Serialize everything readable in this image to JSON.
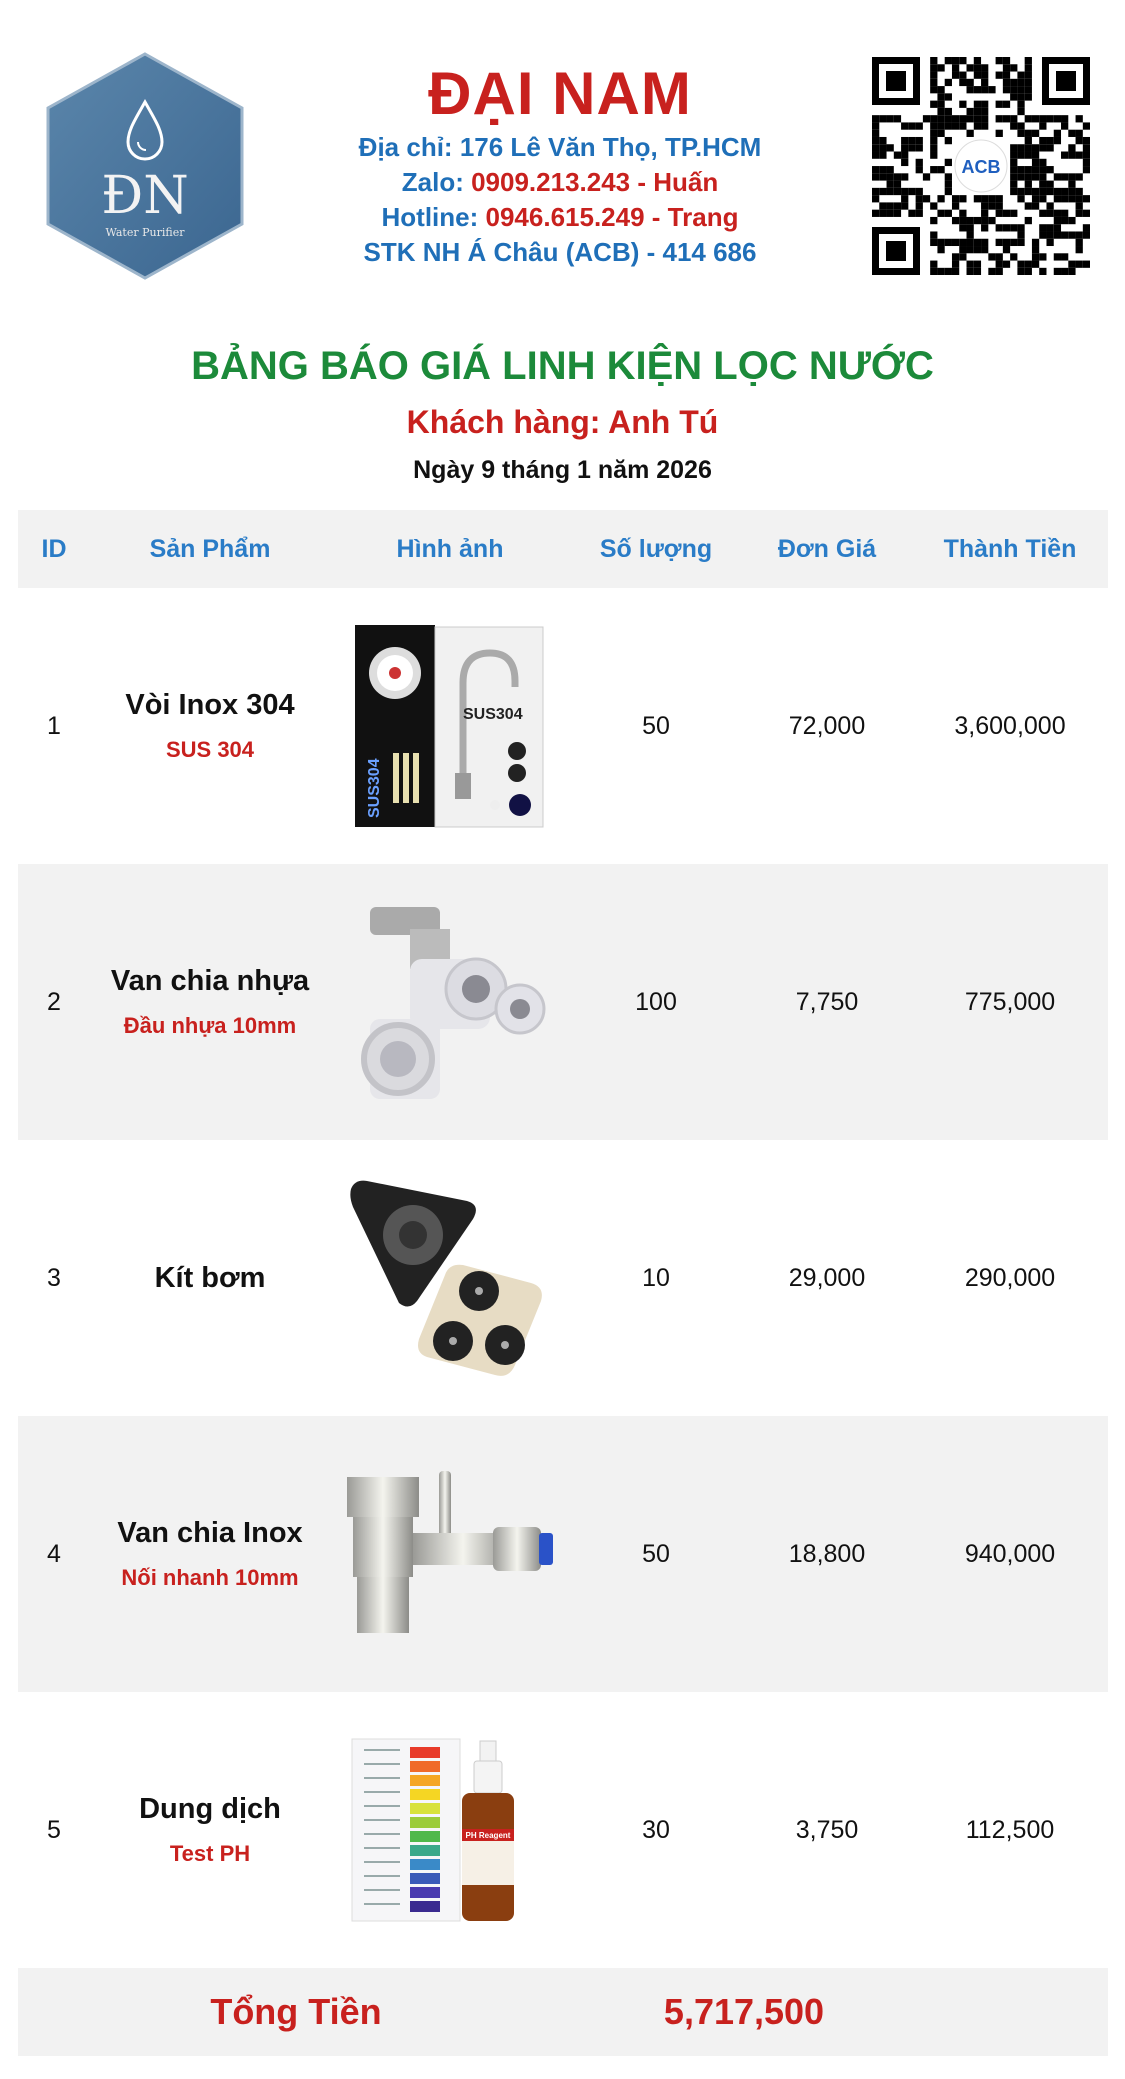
{
  "company": {
    "name": "ĐẠI NAM",
    "address_label": "Địa chỉ:",
    "address": "176 Lê Văn Thọ, TP.HCM",
    "zalo_label": "Zalo:",
    "zalo": "0909.213.243 - Huấn",
    "hotline_label": "Hotline:",
    "hotline": "0946.615.249 - Trang",
    "bank": "STK NH Á Châu (ACB) - 414 686",
    "logo_text": "ĐN",
    "logo_tagline": "Water Purifier",
    "qr_bank": "ACB"
  },
  "doc": {
    "title": "BẢNG BÁO GIÁ LINH KIỆN LỌC NƯỚC",
    "customer": "Khách hàng: Anh Tú",
    "date": "Ngày 9 tháng 1 năm 2026"
  },
  "table": {
    "headers": [
      "ID",
      "Sản Phẩm",
      "Hình ảnh",
      "Số lượng",
      "Đơn Giá",
      "Thành Tiền"
    ],
    "rows": [
      {
        "id": "1",
        "name": "Vòi Inox 304",
        "sub": "SUS 304",
        "image": "stainless-faucet",
        "img_text": "SUS304",
        "qty": "50",
        "unit": "72,000",
        "total": "3,600,000"
      },
      {
        "id": "2",
        "name": "Van chia nhựa",
        "sub": "Đầu nhựa 10mm",
        "image": "plastic-valve",
        "qty": "100",
        "unit": "7,750",
        "total": "775,000"
      },
      {
        "id": "3",
        "name": "Kít bơm",
        "sub": "",
        "image": "pump-kit",
        "qty": "10",
        "unit": "29,000",
        "total": "290,000"
      },
      {
        "id": "4",
        "name": "Van chia Inox",
        "sub": "Nối nhanh 10mm",
        "image": "stainless-valve",
        "qty": "50",
        "unit": "18,800",
        "total": "940,000"
      },
      {
        "id": "5",
        "name": "Dung dịch",
        "sub": "Test PH",
        "image": "ph-reagent",
        "img_text": "PH Reagent",
        "qty": "30",
        "unit": "3,750",
        "total": "112,500"
      }
    ],
    "total_label": "Tổng Tiền",
    "total_value": "5,717,500"
  },
  "colors": {
    "brand_red": "#c8211e",
    "link_blue": "#1f6fb8",
    "title_green": "#1c8a3a",
    "header_blue": "#2a7cc7"
  }
}
